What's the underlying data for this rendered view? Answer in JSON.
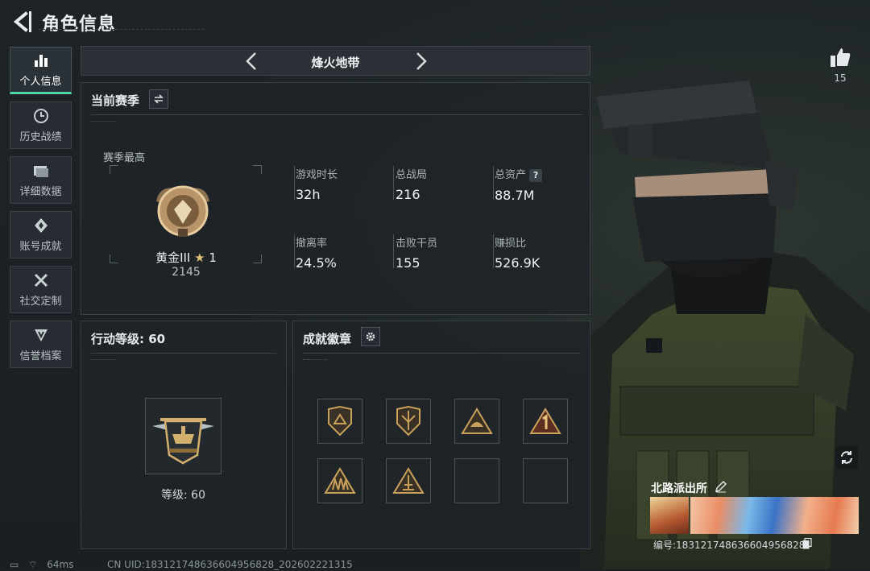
{
  "header": {
    "title": "角色信息"
  },
  "nav": {
    "items": [
      {
        "label": "个人信息",
        "icon": "bar-chart-icon",
        "active": true
      },
      {
        "label": "历史战绩",
        "icon": "clock-icon",
        "active": false
      },
      {
        "label": "详细数据",
        "icon": "folder-icon",
        "active": false
      },
      {
        "label": "账号成就",
        "icon": "achievement-icon",
        "active": false
      },
      {
        "label": "社交定制",
        "icon": "tools-icon",
        "active": false
      },
      {
        "label": "信誉档案",
        "icon": "shield-icon",
        "active": false
      }
    ]
  },
  "mode": {
    "title": "烽火地带"
  },
  "season": {
    "title": "当前赛季",
    "best_label": "赛季最高",
    "rank_name": "黄金III",
    "rank_star": "★",
    "rank_stars_count": "1",
    "rank_score": "2145",
    "stats": [
      {
        "label": "游戏时长",
        "value": "32h"
      },
      {
        "label": "总战局",
        "value": "216"
      },
      {
        "label": "总资产",
        "value": "88.7M",
        "help": "?"
      },
      {
        "label": "撤离率",
        "value": "24.5%"
      },
      {
        "label": "击败干员",
        "value": "155"
      },
      {
        "label": "赚损比",
        "value": "526.9K"
      }
    ]
  },
  "level": {
    "title": "行动等级: 60",
    "level_text": "等级: 60"
  },
  "badges": {
    "title": "成就徽章",
    "slots_filled": 6,
    "slots_total": 8
  },
  "profile": {
    "like_count": "15",
    "card_name": "北路派出所",
    "card_uid": "编号:183121748636604956828"
  },
  "status": {
    "ping": "64ms",
    "uid": "CN UID:183121748636604956828_202602221315"
  },
  "colors": {
    "accent": "#49d7a3",
    "panel": "#1e2428",
    "gold": "#c9a15a"
  }
}
